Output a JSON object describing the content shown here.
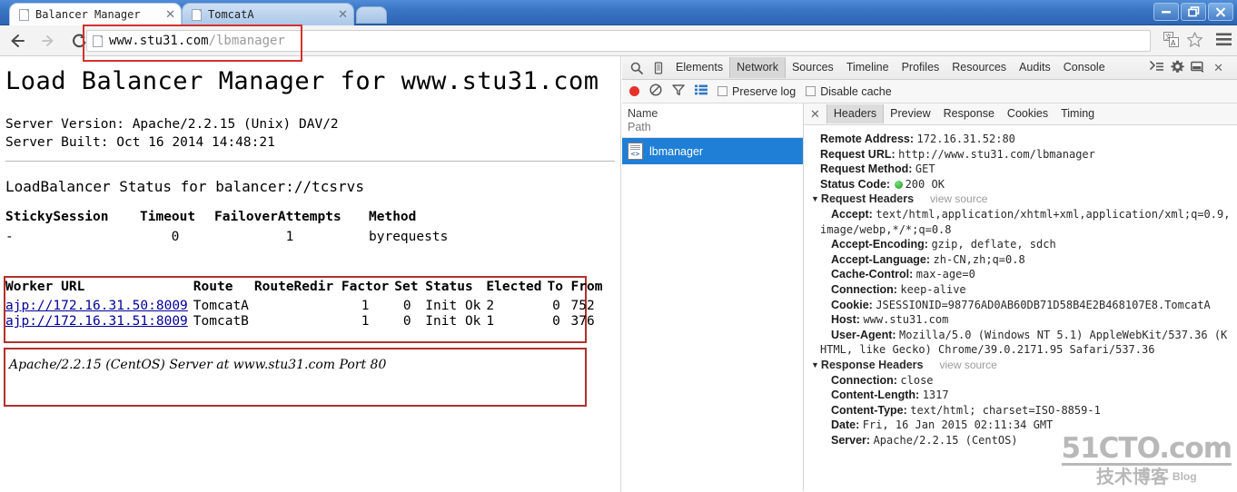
{
  "window": {
    "minimize_label": "–",
    "restore_label": "❐",
    "close_label": "✕"
  },
  "tabs": [
    {
      "label": "Balancer Manager",
      "close_label": "✕",
      "active": true
    },
    {
      "label": "TomcatA",
      "close_label": "✕",
      "active": false
    }
  ],
  "toolbar": {
    "back_icon": "←",
    "forward_icon": "→",
    "reload_icon": "↻",
    "url_host": "www.stu31.com",
    "url_path": "/lbmanager",
    "translate_icon": "translate-icon",
    "bookmark_icon": "☆",
    "menu_icon": "☰"
  },
  "page": {
    "title": "Load Balancer Manager for www.stu31.com",
    "server_version_label": "Server Version:",
    "server_version_value": "Apache/2.2.15 (Unix) DAV/2",
    "server_built_label": "Server Built:",
    "server_built_value": "Oct 16 2014 14:48:21",
    "lb_status_heading": "LoadBalancer Status for balancer://tcsrvs",
    "lb_table": {
      "headers": [
        "StickySession",
        "Timeout",
        "FailoverAttempts",
        "Method"
      ],
      "rows": [
        [
          "-",
          "0",
          "1",
          "byrequests"
        ]
      ]
    },
    "worker_table": {
      "headers": [
        "Worker URL",
        "Route",
        "RouteRedir",
        "Factor",
        "Set",
        "Status",
        "Elected",
        "To",
        "From"
      ],
      "rows": [
        {
          "url": "ajp://172.16.31.50:8009",
          "route": "TomcatA",
          "route_redir": "",
          "factor": "1",
          "set": "0",
          "status": "Init Ok",
          "elected": "2",
          "to": "0",
          "from": "752"
        },
        {
          "url": "ajp://172.16.31.51:8009",
          "route": "TomcatB",
          "route_redir": "",
          "factor": "1",
          "set": "0",
          "status": "Init Ok",
          "elected": "1",
          "to": "0",
          "from": "376"
        }
      ]
    },
    "footer": "Apache/2.2.15 (CentOS) Server at www.stu31.com Port 80"
  },
  "devtools": {
    "search_icon": "⚲",
    "device_icon": "device-toggle-icon",
    "tabs": [
      "Elements",
      "Network",
      "Sources",
      "Timeline",
      "Profiles",
      "Resources",
      "Audits",
      "Console"
    ],
    "selected_tab": "Network",
    "drawer_icon": "≻≡",
    "settings_icon": "⚙",
    "dock_icon": "▭",
    "close_icon": "✕",
    "filterbar": {
      "record_icon": "record-icon",
      "clear_icon": "⊘",
      "filter_icon": "∇",
      "list_icon": "≡",
      "preserve_log_label": "Preserve log",
      "preserve_log_checked": false,
      "disable_cache_label": "Disable cache",
      "disable_cache_checked": false
    },
    "list": {
      "col_name": "Name",
      "col_path": "Path",
      "items": [
        {
          "name": "lbmanager",
          "selected": true
        }
      ]
    },
    "detail": {
      "close_label": "✕",
      "subtabs": [
        "Headers",
        "Preview",
        "Response",
        "Cookies",
        "Timing"
      ],
      "selected_subtab": "Headers",
      "general": [
        {
          "key": "Remote Address:",
          "value": "172.16.31.52:80"
        },
        {
          "key": "Request URL:",
          "value": "http://www.stu31.com/lbmanager"
        },
        {
          "key": "Request Method:",
          "value": "GET"
        },
        {
          "key": "Status Code:",
          "value": "200 OK",
          "status_dot": true
        }
      ],
      "request_headers_title": "Request Headers",
      "view_source_label": "view source",
      "request_headers": [
        {
          "key": "Accept:",
          "value": "text/html,application/xhtml+xml,application/xml;q=0.9,",
          "value2": "image/webp,*/*;q=0.8"
        },
        {
          "key": "Accept-Encoding:",
          "value": "gzip, deflate, sdch"
        },
        {
          "key": "Accept-Language:",
          "value": "zh-CN,zh;q=0.8"
        },
        {
          "key": "Cache-Control:",
          "value": "max-age=0"
        },
        {
          "key": "Connection:",
          "value": "keep-alive"
        },
        {
          "key": "Cookie:",
          "value": "JSESSIONID=98776AD0AB60DB71D58B4E2B468107E8.TomcatA"
        },
        {
          "key": "Host:",
          "value": "www.stu31.com"
        },
        {
          "key": "User-Agent:",
          "value": "Mozilla/5.0 (Windows NT 5.1) AppleWebKit/537.36 (K",
          "value2": "HTML, like Gecko) Chrome/39.0.2171.95 Safari/537.36"
        }
      ],
      "response_headers_title": "Response Headers",
      "response_headers": [
        {
          "key": "Connection:",
          "value": "close"
        },
        {
          "key": "Content-Length:",
          "value": "1317"
        },
        {
          "key": "Content-Type:",
          "value": "text/html; charset=ISO-8859-1"
        },
        {
          "key": "Date:",
          "value": "Fri, 16 Jan 2015 02:11:34 GMT"
        },
        {
          "key": "Server:",
          "value": "Apache/2.2.15 (CentOS)"
        }
      ]
    }
  },
  "watermark": {
    "line1": "51CTO.com",
    "line2": "技术博客",
    "line3": "Blog"
  },
  "colors": {
    "accent": "#1f7fd6",
    "annotation": "#b0302c",
    "status_ok": "#1a9b1a"
  }
}
